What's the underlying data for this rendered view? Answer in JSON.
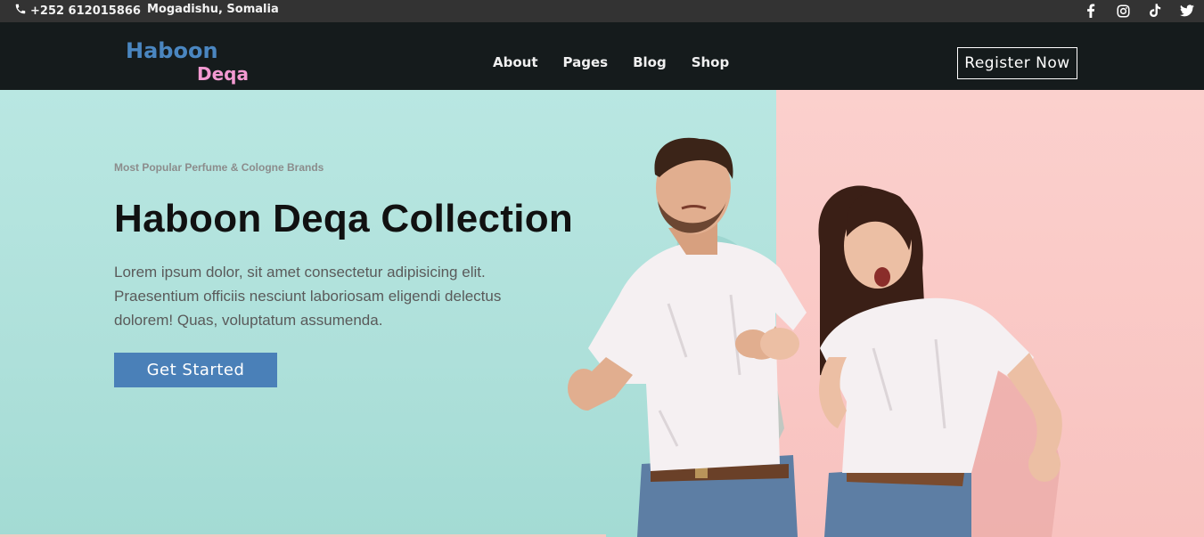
{
  "topbar": {
    "phone": "+252 612015866",
    "location": "Mogadishu, Somalia",
    "social_icons": [
      "facebook-icon",
      "instagram-icon",
      "tiktok-icon",
      "twitter-icon"
    ]
  },
  "brand": {
    "line1": "Haboon",
    "line2": "Deqa",
    "color1": "#4a86c0",
    "color2": "#f39ad2"
  },
  "nav": {
    "items": [
      "About",
      "Pages",
      "Blog",
      "Shop"
    ],
    "register_label": "Register Now"
  },
  "hero": {
    "eyebrow": "Most Popular Perfume & Cologne Brands",
    "title": "Haboon Deqa Collection",
    "description": "Lorem ipsum dolor, sit amet consectetur adipisicing elit. Praesentium officiis nesciunt laboriosam eligendi delectus dolorem! Quas, voluptatum assumenda.",
    "cta_label": "Get Started",
    "colors": {
      "left_bg": "#b9e7e2",
      "right_bg": "#f8c2bf",
      "cta_bg": "#4a80b8"
    }
  }
}
